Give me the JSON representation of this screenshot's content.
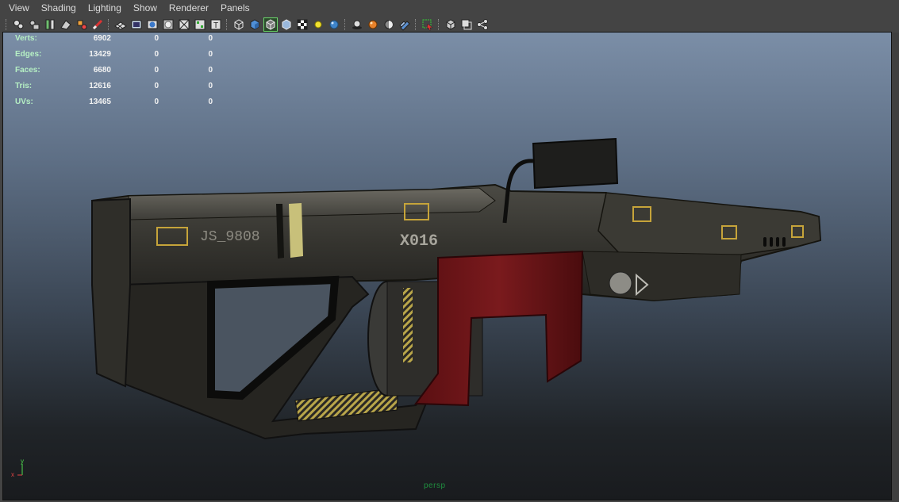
{
  "menu": {
    "items": [
      "View",
      "Shading",
      "Lighting",
      "Show",
      "Renderer",
      "Panels"
    ]
  },
  "toolbar": {
    "icons": [
      "select-camera-icon",
      "camera-attributes-icon",
      "bookmark-icon",
      "image-plane-icon",
      "2d-pan-zoom-icon",
      "grease-pencil-icon",
      "grid-icon",
      "film-gate-icon",
      "resolution-gate-icon",
      "gate-mask-icon",
      "field-chart-icon",
      "safe-title-icon",
      "wireframe-icon",
      "smooth-shade-icon",
      "wireframe-on-shaded-icon",
      "xray-icon",
      "textured-icon",
      "default-lighting-icon",
      "all-lights-icon",
      "shadows-icon",
      "screen-space-ao-icon",
      "motion-blur-icon",
      "multisample-aa-icon",
      "isolate-select-icon",
      "xray-joints-icon",
      "xray-active-icon",
      "node-editor-icon"
    ],
    "active_icon": "wireframe-on-shaded-icon"
  },
  "hud": {
    "rows": [
      {
        "label": "Verts:",
        "c1": "6902",
        "c2": "0",
        "c3": "0"
      },
      {
        "label": "Edges:",
        "c1": "13429",
        "c2": "0",
        "c3": "0"
      },
      {
        "label": "Faces:",
        "c1": "6680",
        "c2": "0",
        "c3": "0"
      },
      {
        "label": "Tris:",
        "c1": "12616",
        "c2": "0",
        "c3": "0"
      },
      {
        "label": "UVs:",
        "c1": "13465",
        "c2": "0",
        "c3": "0"
      }
    ]
  },
  "model": {
    "decal_serial": "JS_9808",
    "decal_code": "X016"
  },
  "axis": {
    "y": "y",
    "x": "x"
  },
  "camera": {
    "name": "persp"
  },
  "colors": {
    "hud_label": "#b6f0c4",
    "hud_value": "#f2f2f2",
    "camera_label": "#1f8f3f",
    "menu_text": "#dcdcdc"
  }
}
